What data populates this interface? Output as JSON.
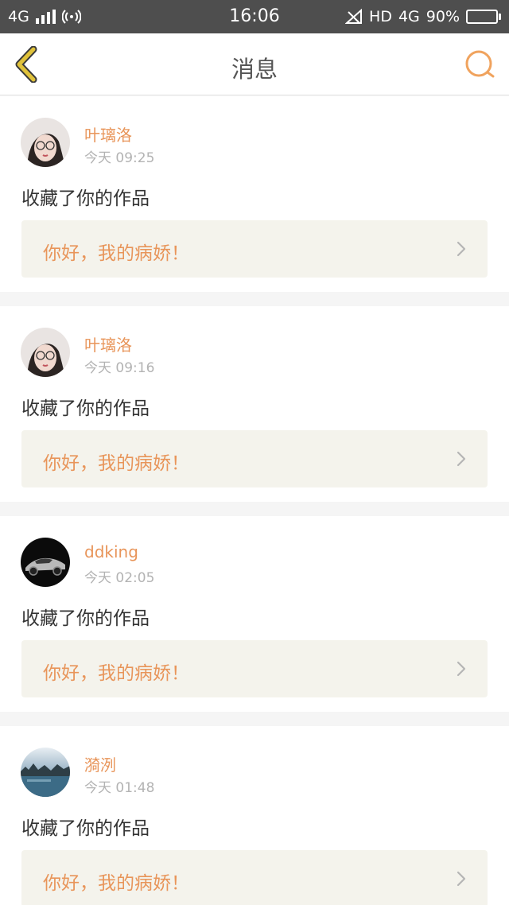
{
  "status_bar": {
    "network_left": "4G",
    "time": "16:06",
    "hd_label": "HD",
    "network_right": "4G",
    "battery": "90%",
    "battery_level": 0.9
  },
  "nav": {
    "title": "消息",
    "back_icon": "chevron-left-icon",
    "search_icon": "search-icon",
    "accent_color": "#f0a35e",
    "back_color": "#e0c23a"
  },
  "messages": [
    {
      "user": "叶璃洛",
      "time": "今天 09:25",
      "action": "收藏了你的作品",
      "work_title": "你好，我的病娇！",
      "avatar": "girl-glasses-avatar"
    },
    {
      "user": "叶璃洛",
      "time": "今天 09:16",
      "action": "收藏了你的作品",
      "work_title": "你好，我的病娇！",
      "avatar": "girl-glasses-avatar"
    },
    {
      "user": "ddking",
      "time": "今天 02:05",
      "action": "收藏了你的作品",
      "work_title": "你好，我的病娇！",
      "avatar": "sports-car-avatar"
    },
    {
      "user": "漪洌",
      "time": "今天 01:48",
      "action": "收藏了你的作品",
      "work_title": "你好，我的病娇！",
      "avatar": "lake-scenery-avatar"
    }
  ]
}
